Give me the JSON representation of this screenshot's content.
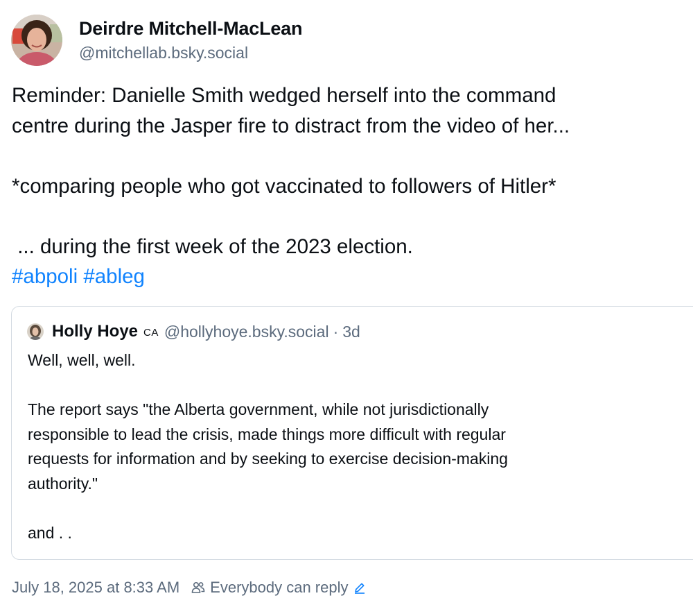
{
  "author": {
    "display_name": "Deirdre Mitchell-MacLean",
    "handle": "@mitchellab.bsky.social"
  },
  "post": {
    "line1": "Reminder: Danielle Smith wedged herself into the command",
    "line2": "centre during the Jasper fire to distract from the video of her...",
    "line3": "*comparing people who got vaccinated to followers of Hitler*",
    "line4": " ... during the first week of the 2023 election.",
    "hashtags": [
      "#abpoli",
      "#ableg"
    ]
  },
  "quote": {
    "display_name": "Holly Hoye",
    "flag": "CA",
    "handle": "@hollyhoye.bsky.social",
    "separator": "·",
    "time": "3d",
    "body": {
      "line1": "Well, well, well.",
      "para2_line1": "The report says \"the Alberta government, while not jurisdictionally",
      "para2_line2": "responsible to lead the crisis, made things more difficult with regular",
      "para2_line3": "requests for information and by seeking to exercise decision-making",
      "para2_line4": "authority.\"",
      "line_last": "and . ."
    }
  },
  "footer": {
    "timestamp": "July 18, 2025 at 8:33 AM",
    "reply_setting": "Everybody can reply"
  },
  "icons": {
    "people": "people-icon",
    "edit": "edit-icon"
  },
  "colors": {
    "text": "#0b0f14",
    "muted": "#5c6b7d",
    "link": "#1083fe",
    "border": "#d4dbe2"
  }
}
